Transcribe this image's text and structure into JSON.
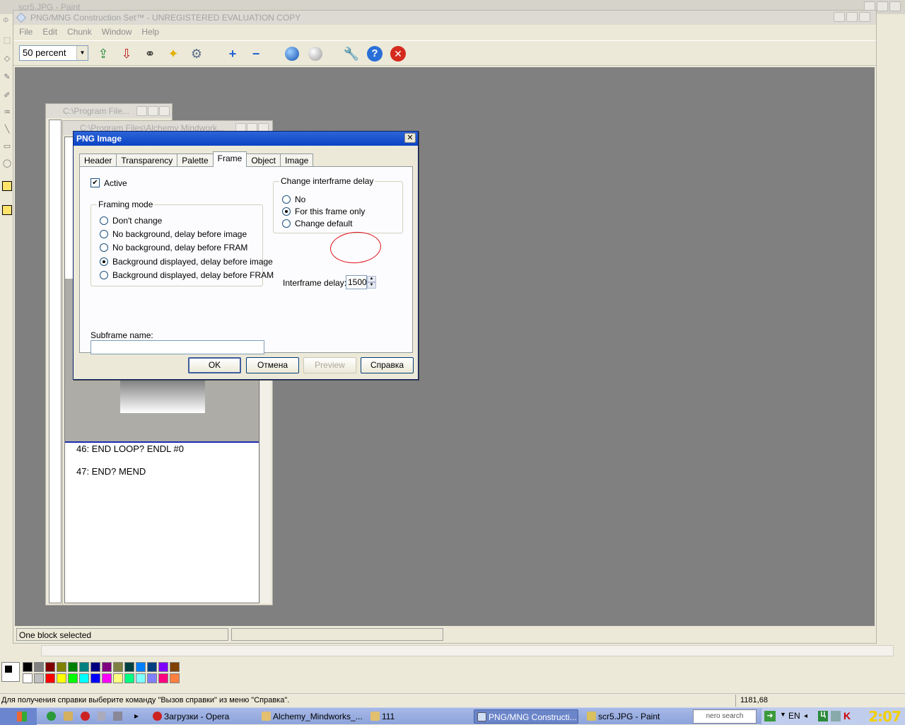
{
  "paint": {
    "window_title": "scr5.JPG - Paint",
    "menu_stub": "Ф",
    "status_text": "Для получения справки выберите команду \"Вызов справки\" из меню \"Справка\".",
    "coords": "1181,68",
    "palette_top": [
      "#000000",
      "#808080",
      "#800000",
      "#808000",
      "#008000",
      "#008080",
      "#000080",
      "#800080",
      "#808040",
      "#004040",
      "#0080ff",
      "#004080",
      "#8000ff",
      "#804000"
    ],
    "palette_bottom": [
      "#ffffff",
      "#c0c0c0",
      "#ff0000",
      "#ffff00",
      "#00ff00",
      "#00ffff",
      "#0000ff",
      "#ff00ff",
      "#ffff80",
      "#00ff80",
      "#80ffff",
      "#8080ff",
      "#ff0080",
      "#ff8040"
    ]
  },
  "mng": {
    "window_title": "PNG/MNG Construction Set™ - UNREGISTERED EVALUATION COPY",
    "menu": [
      "File",
      "Edit",
      "Chunk",
      "Window",
      "Help"
    ],
    "zoom_value": "50 percent",
    "toolbar_icons": [
      "import-icon",
      "export-icon",
      "binoculars-icon",
      "magic-wand-icon",
      "gear-icon",
      "plus-icon",
      "minus-icon",
      "blue-sphere-icon",
      "gray-sphere-icon",
      "wrench-icon",
      "help-icon",
      "close-icon"
    ],
    "status_left": "One block selected",
    "status_right": ""
  },
  "child1": {
    "title": "C:\\Program File..."
  },
  "child2": {
    "title": "C:\\Program Files\\Alchemy Mindwork...",
    "lines": [
      "46: END LOOP? ENDL #0",
      "47: END? MEND"
    ]
  },
  "dialog": {
    "title": "PNG Image",
    "tabs": [
      "Header",
      "Transparency",
      "Palette",
      "Frame",
      "Object",
      "Image"
    ],
    "active_tab": "Frame",
    "active_label": "Active",
    "framing_mode_legend": "Framing mode",
    "framing_options": [
      "Don't change",
      "No background, delay before image",
      "No background, delay before FRAM",
      "Background displayed, delay before image",
      "Background displayed, delay before FRAM"
    ],
    "framing_selected": 3,
    "delay_legend": "Change interframe delay",
    "delay_options": [
      "No",
      "For this frame only",
      "Change default"
    ],
    "delay_selected": 1,
    "interframe_label": "Interframe delay:",
    "interframe_value": "1500",
    "subframe_label": "Subframe name:",
    "subframe_value": "",
    "buttons": {
      "ok": "OK",
      "cancel": "Отмена",
      "preview": "Preview",
      "help": "Справка"
    }
  },
  "taskbar": {
    "items": [
      {
        "label": "Загрузки - Opera",
        "active": false
      },
      {
        "label": "Alchemy_Mindworks_...",
        "active": false
      },
      {
        "label": "111",
        "active": false
      },
      {
        "label": "PNG/MNG Constructi...",
        "active": true
      },
      {
        "label": "scr5.JPG - Paint",
        "active": false
      }
    ],
    "search_label": "nero search",
    "lang": "EN",
    "clock": "2:07"
  }
}
